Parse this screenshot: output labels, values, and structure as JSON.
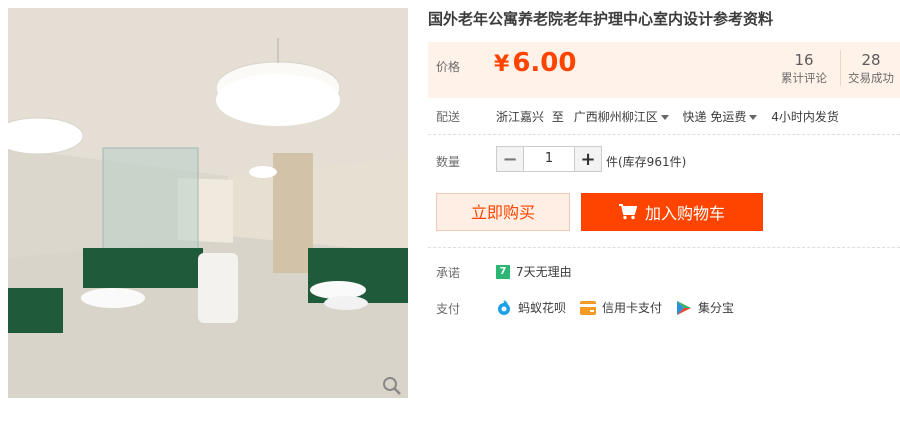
{
  "product": {
    "title": "国外老年公寓养老院老年护理中心室内设计参考资料",
    "price_label": "价格",
    "currency": "¥",
    "price": "6.00",
    "stats": [
      {
        "num": "16",
        "label": "累计评论"
      },
      {
        "num": "28",
        "label": "交易成功"
      }
    ]
  },
  "shipping": {
    "label": "配送",
    "from": "浙江嘉兴",
    "to_word": "至",
    "destination": "广西柳州柳江区",
    "method": "快递 免运费",
    "dispatch": "4小时内发货"
  },
  "quantity": {
    "label": "数量",
    "minus": "−",
    "value": "1",
    "plus": "+",
    "stock": "件(库存961件)"
  },
  "buttons": {
    "buy_now": "立即购买",
    "add_cart": "加入购物车"
  },
  "promise": {
    "label": "承诺",
    "badge": "7",
    "text": "7天无理由"
  },
  "payment": {
    "label": "支付",
    "methods": [
      {
        "icon": "ant-huabei-icon",
        "label": "蚂蚁花呗"
      },
      {
        "icon": "credit-card-icon",
        "label": "信用卡支付"
      },
      {
        "icon": "jifenbao-icon",
        "label": "集分宝"
      }
    ]
  },
  "colors": {
    "accent": "#ff4400",
    "price_bg": "#fff2e8",
    "buy_now_bg": "#ffeee3",
    "promise_green": "#2bb673"
  }
}
